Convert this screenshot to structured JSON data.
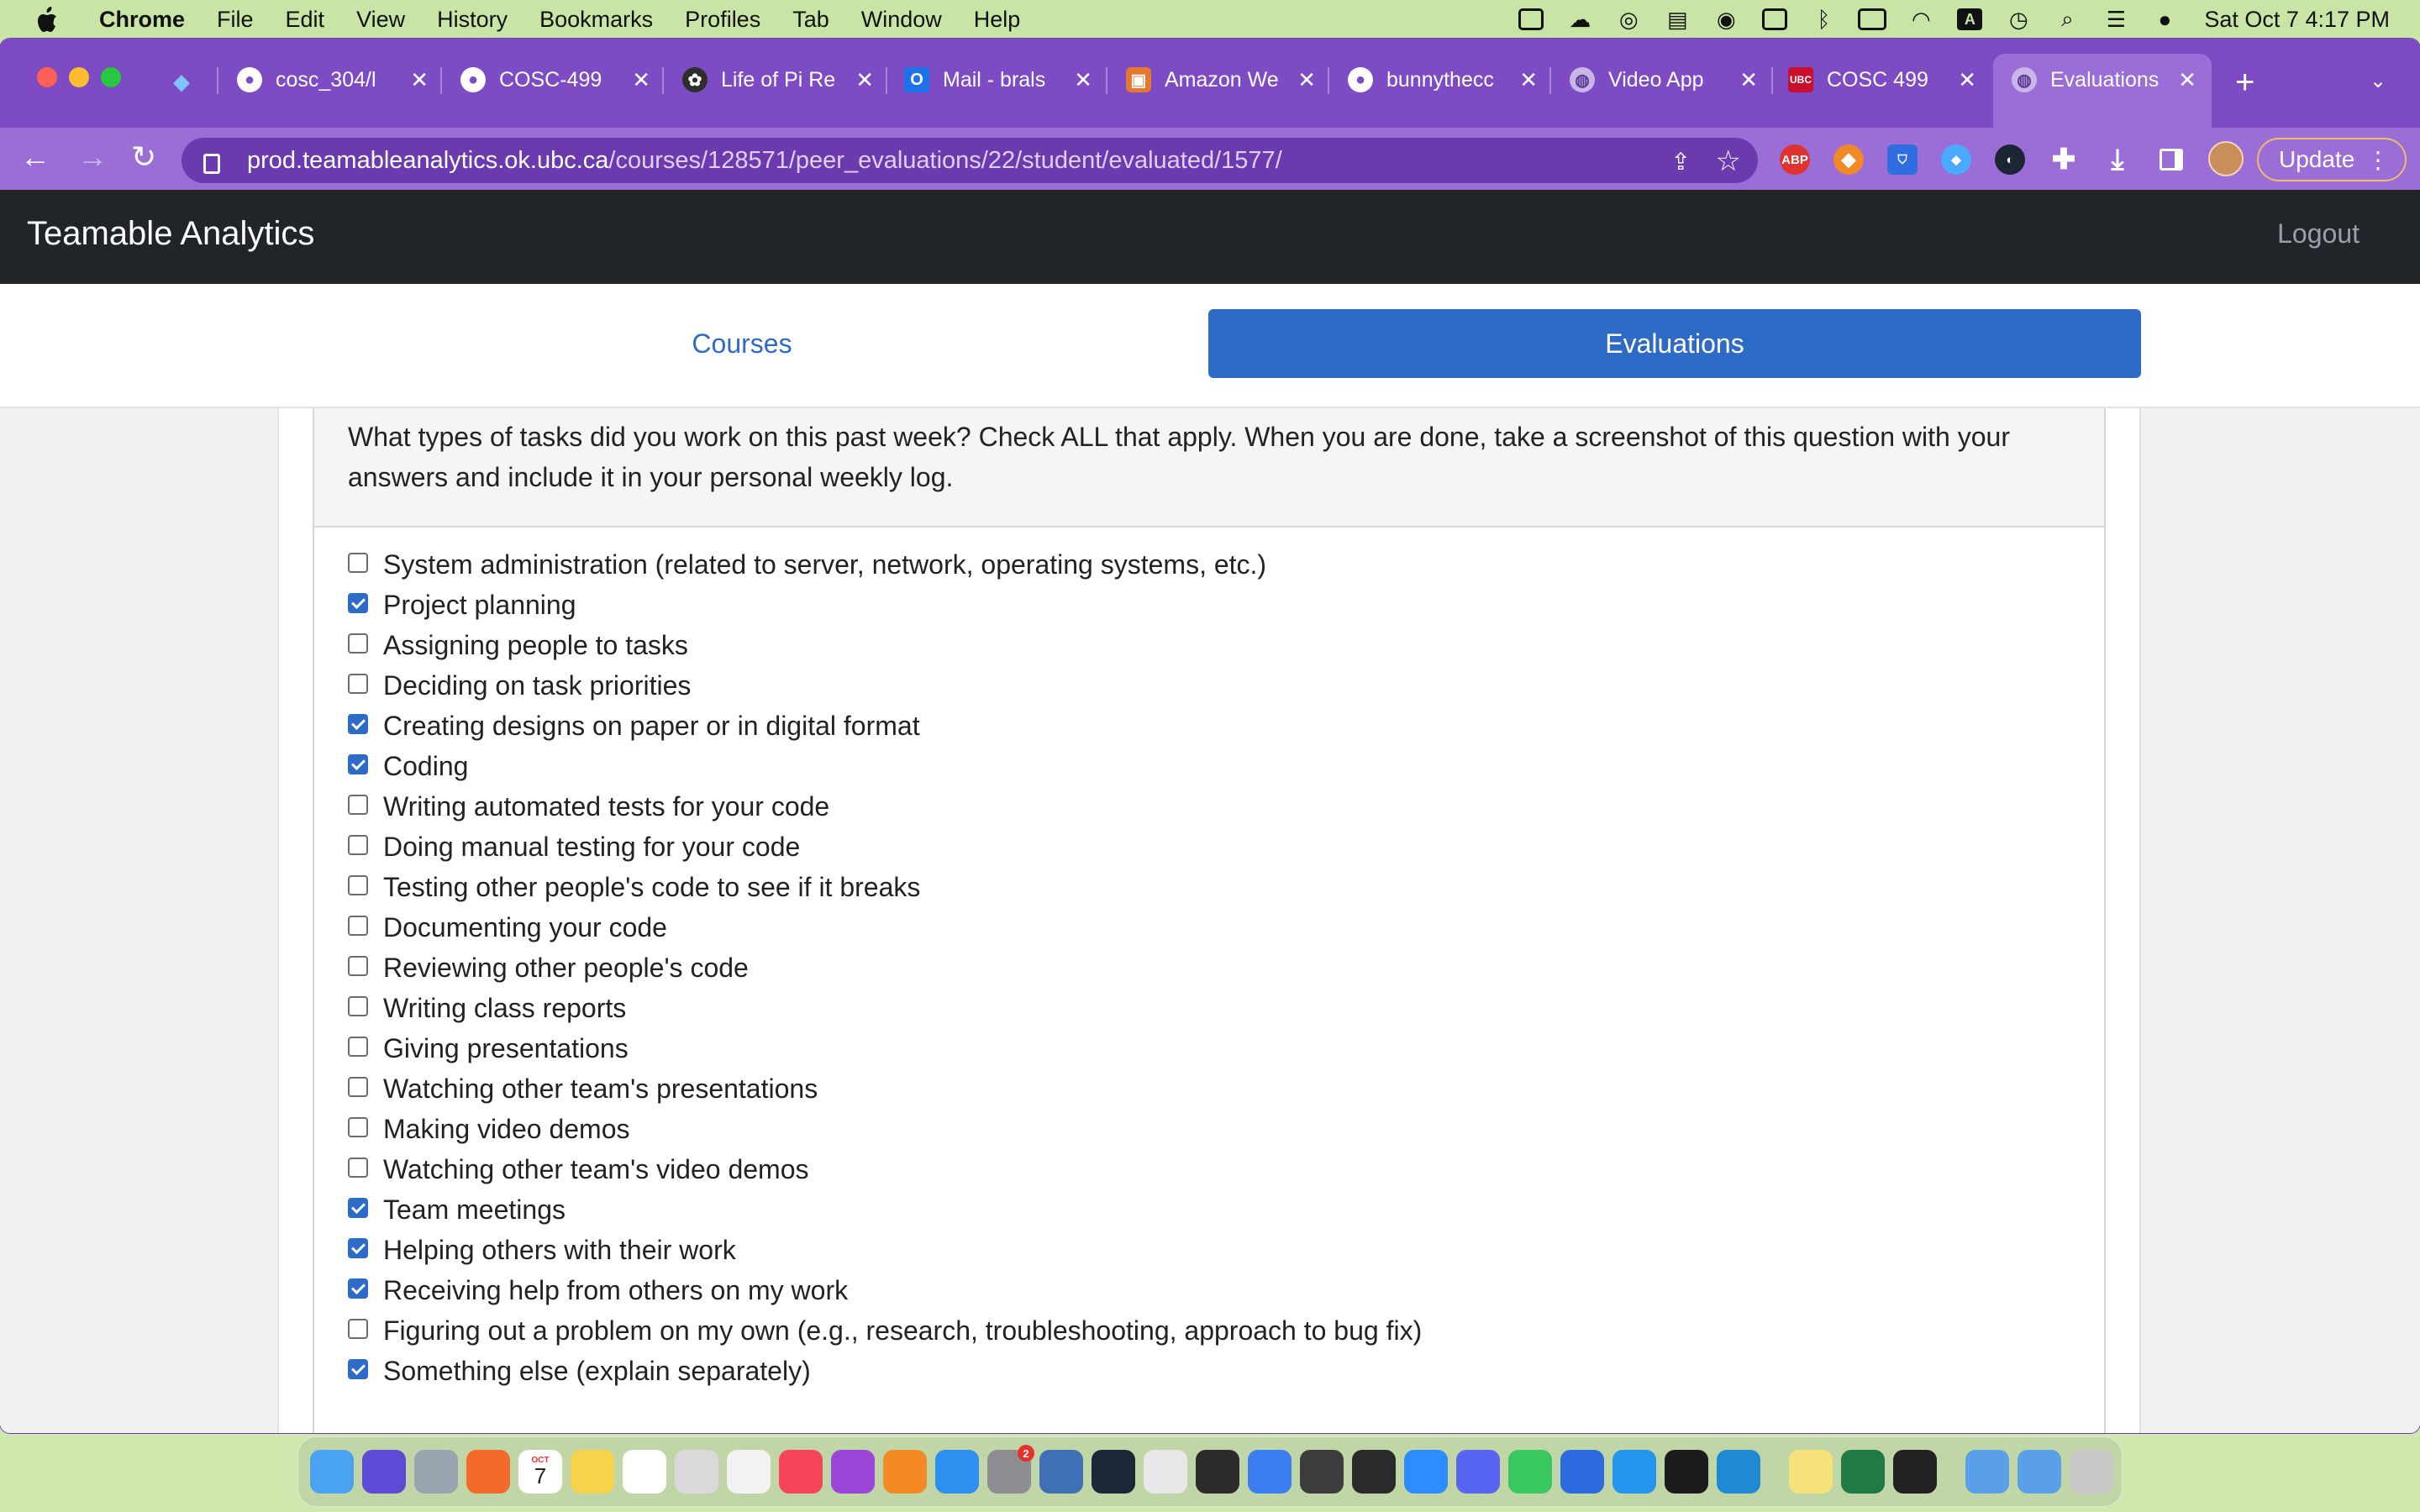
{
  "menubar": {
    "app_name": "Chrome",
    "items": [
      "File",
      "Edit",
      "View",
      "History",
      "Bookmarks",
      "Profiles",
      "Tab",
      "Window",
      "Help"
    ],
    "clock": "Sat Oct 7  4:17 PM",
    "keyboard_indicator": "A"
  },
  "browser": {
    "tabs": [
      {
        "label": "cosc_304/l",
        "icon": "github-icon"
      },
      {
        "label": "COSC-499",
        "icon": "github-icon"
      },
      {
        "label": "Life of Pi Re",
        "icon": "chatgpt-icon"
      },
      {
        "label": "Mail - brals",
        "icon": "outlook-icon"
      },
      {
        "label": "Amazon We",
        "icon": "aws-icon"
      },
      {
        "label": "bunnythecc",
        "icon": "github-icon"
      },
      {
        "label": "Video App",
        "icon": "globe-icon"
      },
      {
        "label": "COSC 499",
        "icon": "ubc-canvas-icon"
      },
      {
        "label": "Evaluations",
        "icon": "globe-icon"
      }
    ],
    "url_host": "prod.teamableanalytics.ok.ubc.ca",
    "url_path": "/courses/128571/peer_evaluations/22/student/evaluated/1577/",
    "update_label": "Update",
    "extensions": {
      "abp": "ABP"
    }
  },
  "app": {
    "brand": "Teamable Analytics",
    "logout": "Logout",
    "nav": {
      "courses": "Courses",
      "evaluations": "Evaluations"
    }
  },
  "question": {
    "prompt": "What types of tasks did you work on this past week? Check ALL that apply. When you are done, take a screenshot of this question with your answers and include it in your personal weekly log.",
    "options": [
      {
        "label": "System administration (related to server, network, operating systems, etc.)",
        "checked": false
      },
      {
        "label": "Project planning",
        "checked": true
      },
      {
        "label": "Assigning people to tasks",
        "checked": false
      },
      {
        "label": "Deciding on task priorities",
        "checked": false
      },
      {
        "label": "Creating designs on paper or in digital format",
        "checked": true
      },
      {
        "label": "Coding",
        "checked": true
      },
      {
        "label": "Writing automated tests for your code",
        "checked": false
      },
      {
        "label": "Doing manual testing for your code",
        "checked": false
      },
      {
        "label": "Testing other people's code to see if it breaks",
        "checked": false
      },
      {
        "label": "Documenting your code",
        "checked": false
      },
      {
        "label": "Reviewing other people's code",
        "checked": false
      },
      {
        "label": "Writing class reports",
        "checked": false
      },
      {
        "label": "Giving presentations",
        "checked": false
      },
      {
        "label": "Watching other team's presentations",
        "checked": false
      },
      {
        "label": "Making video demos",
        "checked": false
      },
      {
        "label": "Watching other team's video demos",
        "checked": false
      },
      {
        "label": "Team meetings",
        "checked": true
      },
      {
        "label": "Helping others with their work",
        "checked": true
      },
      {
        "label": "Receiving help from others on my work",
        "checked": true
      },
      {
        "label": "Figuring out a problem on my own (e.g., research, troubleshooting, approach to bug fix)",
        "checked": false
      },
      {
        "label": "Something else (explain separately)",
        "checked": true
      }
    ]
  },
  "dock": {
    "apps": [
      "finder",
      "siri",
      "launchpad",
      "firefox",
      "calendar",
      "notes",
      "freeform",
      "screenshot",
      "photos",
      "music",
      "podcasts",
      "books",
      "app-store",
      "system-settings",
      "virtualbox",
      "steam",
      "chrome",
      "cleanmymac",
      "outline",
      "disk-utility",
      "final-cut",
      "zoom",
      "discord",
      "messages",
      "mail-m",
      "docker",
      "terminal-alt",
      "vscode",
      "stickies",
      "excel",
      "terminal",
      "downloads-folder",
      "applications-folder",
      "trash"
    ],
    "calendar_date": "7",
    "calendar_month": "OCT",
    "settings_badge": "2"
  }
}
